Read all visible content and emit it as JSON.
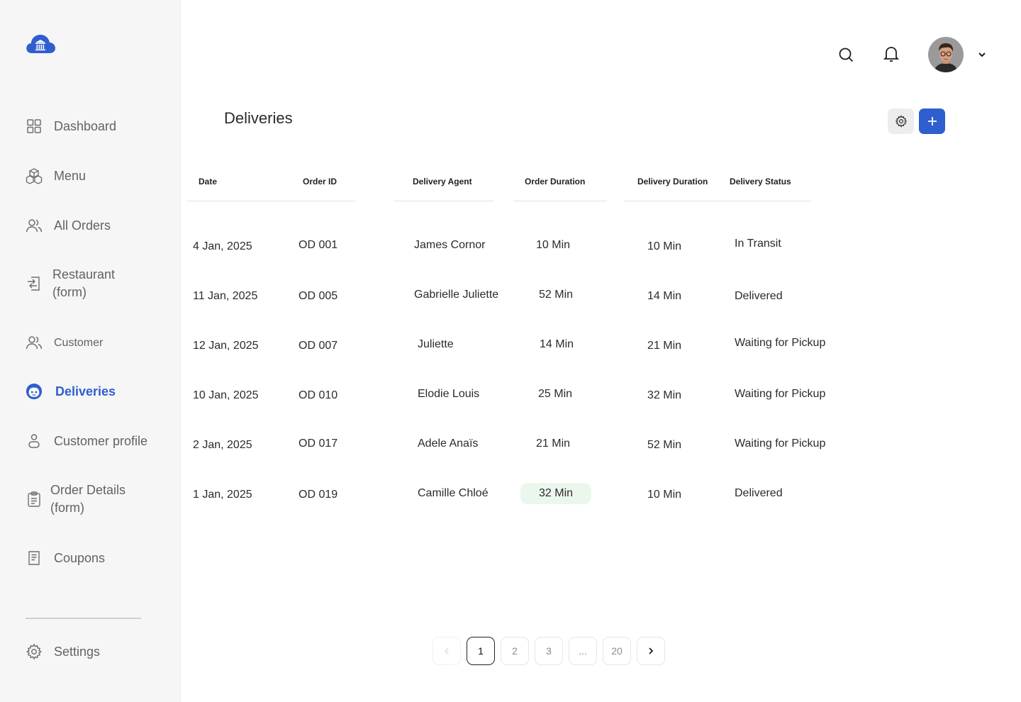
{
  "sidebar": {
    "logo_icon": "cloud-bank-logo",
    "items": [
      {
        "label": "Dashboard",
        "icon": "grid-icon"
      },
      {
        "label": "Menu",
        "icon": "boxes-icon"
      },
      {
        "label": "All Orders",
        "icon": "users-icon"
      },
      {
        "label": "Restaurant (form)",
        "icon": "transfer-icon"
      },
      {
        "label": "Customer",
        "icon": "users-icon"
      },
      {
        "label": "Deliveries",
        "icon": "face-icon"
      },
      {
        "label": "Customer profile",
        "icon": "person-icon"
      },
      {
        "label": "Order Details (form)",
        "icon": "clipboard-icon"
      },
      {
        "label": "Coupons",
        "icon": "receipt-icon"
      }
    ],
    "settings_label": "Settings",
    "active_color": "#2f5fcf"
  },
  "header": {
    "search_icon": "search-icon",
    "notification_icon": "bell-icon",
    "avatar": "user-avatar"
  },
  "page": {
    "title": "Deliveries"
  },
  "table": {
    "columns": [
      "Date",
      "Order ID",
      "Delivery Agent",
      "Order Duration",
      "Delivery Duration",
      "Delivery Status"
    ],
    "rows": [
      {
        "date": "4 Jan, 2025",
        "order_id": "OD 001",
        "agent": "James Cornor",
        "order_duration": "10 Min",
        "delivery_duration": "10 Min",
        "status": "In Transit"
      },
      {
        "date": "11 Jan, 2025",
        "order_id": "OD 005",
        "agent": "Gabrielle Juliette",
        "order_duration": "52 Min",
        "delivery_duration": "14 Min",
        "status": "Delivered"
      },
      {
        "date": "12 Jan, 2025",
        "order_id": "OD 007",
        "agent": "Juliette",
        "order_duration": "14 Min",
        "delivery_duration": "21 Min",
        "status": "Waiting for Pickup"
      },
      {
        "date": "10 Jan, 2025",
        "order_id": "OD 010",
        "agent": "Elodie Louis",
        "order_duration": "25 Min",
        "delivery_duration": "32 Min",
        "status": "Waiting for Pickup"
      },
      {
        "date": "2 Jan, 2025",
        "order_id": "OD 017",
        "agent": "Adele Anaïs",
        "order_duration": "21 Min",
        "delivery_duration": "52 Min",
        "status": "Waiting for Pickup"
      },
      {
        "date": "1 Jan, 2025",
        "order_id": "OD 019",
        "agent": "Camille Chloé",
        "order_duration": "32 Min",
        "delivery_duration": "10 Min",
        "status": "Delivered"
      }
    ],
    "highlight_color": "#ebf6ec"
  },
  "pagination": {
    "pages": [
      "1",
      "2",
      "3",
      "...",
      "20"
    ],
    "current": "1"
  }
}
